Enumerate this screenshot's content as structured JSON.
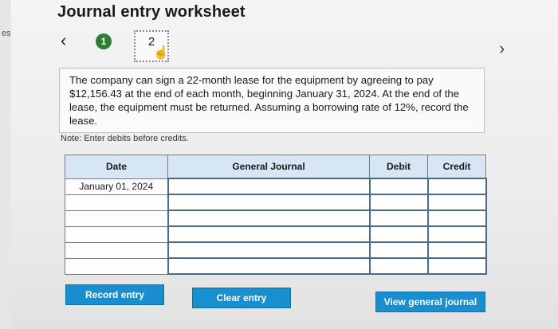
{
  "page": {
    "side_fragment": "es",
    "title": "Journal entry worksheet"
  },
  "steps": {
    "prev_icon": "chevron-left",
    "next_icon": "chevron-right",
    "step1": "1",
    "step2": "2"
  },
  "problem": {
    "text": "The company can sign a 22-month lease for the equipment by agreeing to pay $12,156.43 at the end of each month, beginning January 31, 2024. At the end of the lease, the equipment must be returned. Assuming a borrowing rate of 12%, record the lease."
  },
  "note": "Note: Enter debits before credits.",
  "table": {
    "headers": {
      "date": "Date",
      "account": "General Journal",
      "debit": "Debit",
      "credit": "Credit"
    },
    "rows": [
      {
        "date": "January 01, 2024",
        "account": "",
        "debit": "",
        "credit": ""
      },
      {
        "date": "",
        "account": "",
        "debit": "",
        "credit": ""
      },
      {
        "date": "",
        "account": "",
        "debit": "",
        "credit": ""
      },
      {
        "date": "",
        "account": "",
        "debit": "",
        "credit": ""
      },
      {
        "date": "",
        "account": "",
        "debit": "",
        "credit": ""
      },
      {
        "date": "",
        "account": "",
        "debit": "",
        "credit": ""
      }
    ]
  },
  "buttons": {
    "record": "Record entry",
    "clear": "Clear entry",
    "view": "View general journal"
  },
  "colors": {
    "step_green": "#2e7d32",
    "button_blue": "#1a8fcf",
    "header_blue": "#d6e6f5"
  }
}
